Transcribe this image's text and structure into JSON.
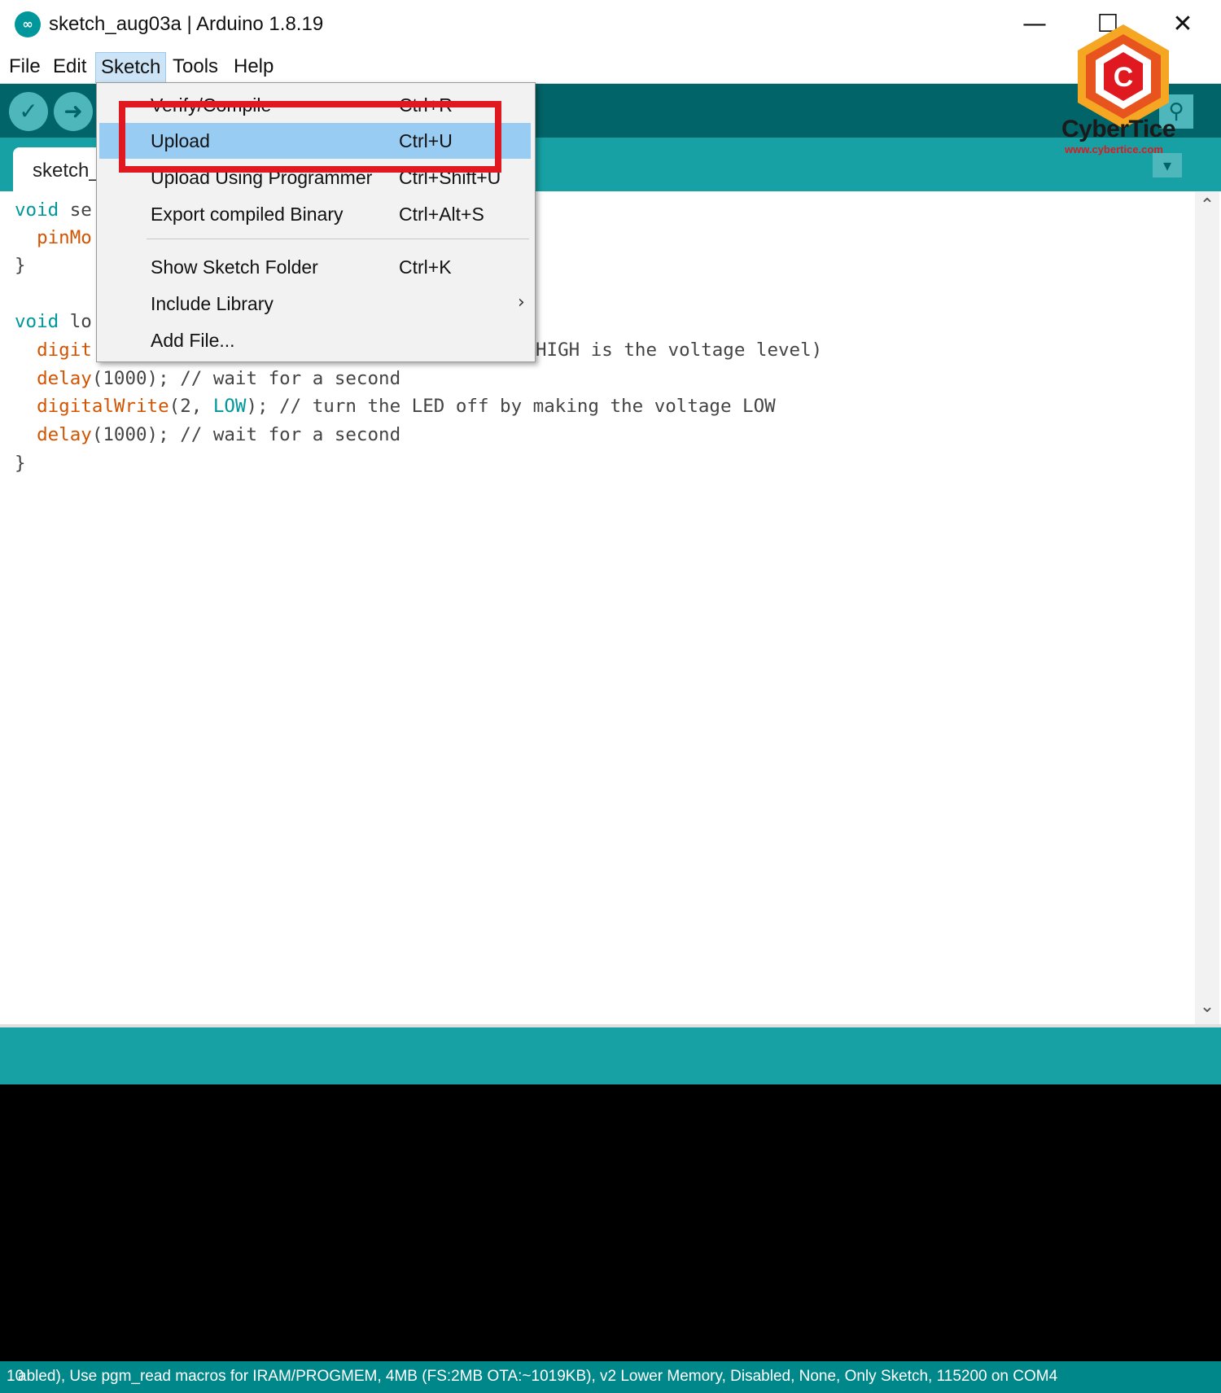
{
  "window": {
    "title": "sketch_aug03a | Arduino 1.8.19",
    "app_icon": "arduino-infinity-icon",
    "app_icon_glyph": "∞",
    "minimize_glyph": "—",
    "maximize_glyph": "☐",
    "close_glyph": "✕"
  },
  "menubar": {
    "items": [
      "File",
      "Edit",
      "Sketch",
      "Tools",
      "Help"
    ],
    "active": "Sketch"
  },
  "toolbar": {
    "verify_icon": "✓",
    "upload_icon": "➜",
    "serial_monitor_icon": "⚲"
  },
  "tab": {
    "label": "sketch_",
    "menu_icon": "▾"
  },
  "sketch_menu": {
    "items": [
      {
        "label": "Verify/Compile",
        "shortcut": "Ctrl+R"
      },
      {
        "label": "Upload",
        "shortcut": "Ctrl+U",
        "highlighted": true
      },
      {
        "label": "Upload Using Programmer",
        "shortcut": "Ctrl+Shift+U"
      },
      {
        "label": "Export compiled Binary",
        "shortcut": "Ctrl+Alt+S"
      },
      {
        "label": "Show Sketch Folder",
        "shortcut": "Ctrl+K"
      },
      {
        "label": "Include Library",
        "shortcut": "",
        "submenu": true
      },
      {
        "label": "Add File...",
        "shortcut": ""
      }
    ],
    "submenu_arrow": "›"
  },
  "code": {
    "line1_kw": "void",
    "line1_rest": " se",
    "line2_fn": "pinMo",
    "line3": "}",
    "line5_kw": "void",
    "line5_rest": " lo",
    "line6_fn": "digit",
    "line6_visible_tail": "HIGH is the voltage level)",
    "line7_fn": "delay",
    "line7_rest": "(1000); // wait for a second",
    "line8_fn": "digitalWrite",
    "line8_a": "(2, ",
    "line8_kw": "LOW",
    "line8_b": "); // turn the LED off by making the voltage LOW",
    "line9_fn": "delay",
    "line9_rest": "(1000); // wait for a second",
    "line10": "}"
  },
  "scrollbar": {
    "up_icon": "⌃",
    "down_icon": "⌄"
  },
  "status": {
    "line_number": "10",
    "text": "abled), Use pgm_read macros for IRAM/PROGMEM, 4MB (FS:2MB OTA:~1019KB), v2 Lower Memory, Disabled, None, Only Sketch, 115200 on COM4"
  },
  "watermark": {
    "name": "CyberTice",
    "url": "www.cybertice.com",
    "letter": "C"
  },
  "colors": {
    "toolbar": "#006468",
    "tabstrip": "#17a1a5",
    "highlight": "#99ccf3",
    "annotation": "#e0181f"
  }
}
